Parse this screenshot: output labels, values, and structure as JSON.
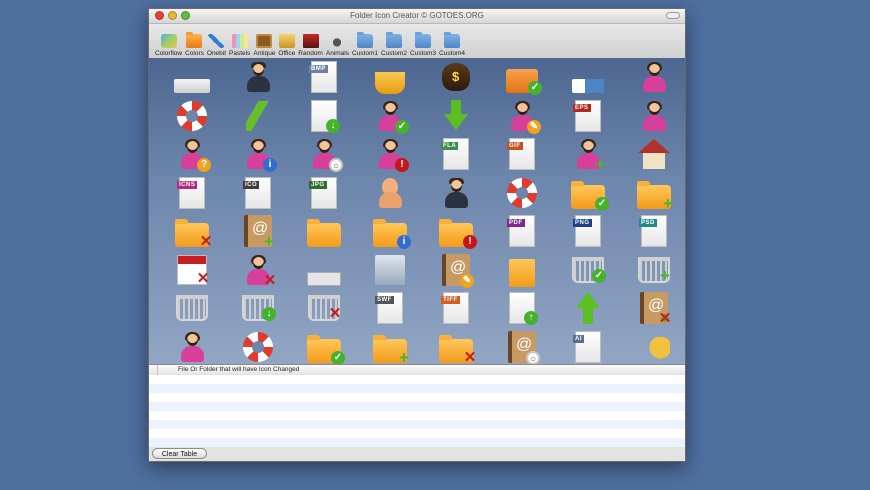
{
  "window": {
    "title": "Folder Icon Creator © GOTOES.ORG"
  },
  "toolbar": {
    "items": [
      {
        "label": "Colorflow",
        "icon": "colorflow-icon"
      },
      {
        "label": "Colors",
        "icon": "folder-orange-icon"
      },
      {
        "label": "Onebit",
        "icon": "pencil-icon"
      },
      {
        "label": "Pastels",
        "icon": "pastels-icon"
      },
      {
        "label": "Antique",
        "icon": "antique-frame-icon"
      },
      {
        "label": "Office",
        "icon": "office-icon"
      },
      {
        "label": "Random",
        "icon": "random-book-icon"
      },
      {
        "label": "Animals",
        "icon": "animal-icon"
      },
      {
        "label": "Custom1",
        "icon": "folder-blue-icon"
      },
      {
        "label": "Custom2",
        "icon": "folder-blue-icon"
      },
      {
        "label": "Custom3",
        "icon": "folder-blue-icon"
      },
      {
        "label": "Custom4",
        "icon": "folder-blue-icon"
      }
    ]
  },
  "icon_grid": {
    "rows": [
      [
        {
          "icon": "slab-icon"
        },
        {
          "icon": "man-user-icon"
        },
        {
          "icon": "bmp-file-icon",
          "tag": "BMP"
        },
        {
          "icon": "coffee-cup-icon"
        },
        {
          "icon": "money-bag-icon"
        },
        {
          "icon": "camera-check-icon"
        },
        {
          "icon": "eraser-icon"
        },
        {
          "icon": "couple-users-icon"
        }
      ],
      [
        {
          "icon": "lifering-icon"
        },
        {
          "icon": "winding-road-icon"
        },
        {
          "icon": "download-file-icon"
        },
        {
          "icon": "woman-user-check-icon"
        },
        {
          "icon": "green-down-arrow-icon"
        },
        {
          "icon": "woman-user-edit-icon"
        },
        {
          "icon": "eps-file-icon",
          "tag": "EPS"
        },
        {
          "icon": "family-users-icon"
        }
      ],
      [
        {
          "icon": "woman-user-help-icon"
        },
        {
          "icon": "woman-user-info-icon"
        },
        {
          "icon": "woman-user-search-icon"
        },
        {
          "icon": "woman-user-alert-icon"
        },
        {
          "icon": "fla-file-icon",
          "tag": "FLA"
        },
        {
          "icon": "gif-file-icon",
          "tag": "GIF"
        },
        {
          "icon": "woman-user-add-icon"
        },
        {
          "icon": "house-icon"
        }
      ],
      [
        {
          "icon": "icns-file-icon",
          "tag": "ICNS"
        },
        {
          "icon": "ico-file-icon",
          "tag": "ICO"
        },
        {
          "icon": "jpg-file-icon",
          "tag": "JPG"
        },
        {
          "icon": "bald-user-icon"
        },
        {
          "icon": "businessman-user-icon"
        },
        {
          "icon": "lifering-user-icon"
        },
        {
          "icon": "folder-check-icon"
        },
        {
          "icon": "folder-add-icon"
        }
      ],
      [
        {
          "icon": "folder-delete-icon"
        },
        {
          "icon": "address-book-add-icon"
        },
        {
          "icon": "folder-open-icon"
        },
        {
          "icon": "folder-info-icon"
        },
        {
          "icon": "folder-alert-icon"
        },
        {
          "icon": "pdf-file-icon",
          "tag": "PDF"
        },
        {
          "icon": "png-file-icon",
          "tag": "PNG"
        },
        {
          "icon": "psd-file-icon",
          "tag": "PSD"
        }
      ],
      [
        {
          "icon": "calendar-delete-icon"
        },
        {
          "icon": "woman-user-delete-icon"
        },
        {
          "icon": "keyboard-icon"
        },
        {
          "icon": "fax-icon"
        },
        {
          "icon": "address-book-edit-icon"
        },
        {
          "icon": "shopping-bag-icon"
        },
        {
          "icon": "cart-check-icon"
        },
        {
          "icon": "cart-add-icon"
        }
      ],
      [
        {
          "icon": "cart-icon"
        },
        {
          "icon": "cart-download-icon"
        },
        {
          "icon": "cart-delete-icon"
        },
        {
          "icon": "swf-file-icon",
          "tag": "SWF"
        },
        {
          "icon": "tiff-file-icon",
          "tag": "TIFF"
        },
        {
          "icon": "upload-file-icon"
        },
        {
          "icon": "green-up-arrow-icon"
        },
        {
          "icon": "address-book-delete-icon"
        }
      ],
      [
        {
          "icon": "woman-user-icon"
        },
        {
          "icon": "lifering-user-folder-icon"
        },
        {
          "icon": "folder-open-check-icon"
        },
        {
          "icon": "folder-open-add-icon"
        },
        {
          "icon": "folder-open-delete-icon"
        },
        {
          "icon": "address-book-search-icon"
        },
        {
          "icon": "ai-file-icon",
          "tag": "AI"
        },
        {
          "icon": "baby-pram-icon"
        }
      ]
    ]
  },
  "file_list": {
    "column_header": "File Or Folder that will have Icon Changed"
  },
  "footer": {
    "clear_button": "Clear Table"
  }
}
